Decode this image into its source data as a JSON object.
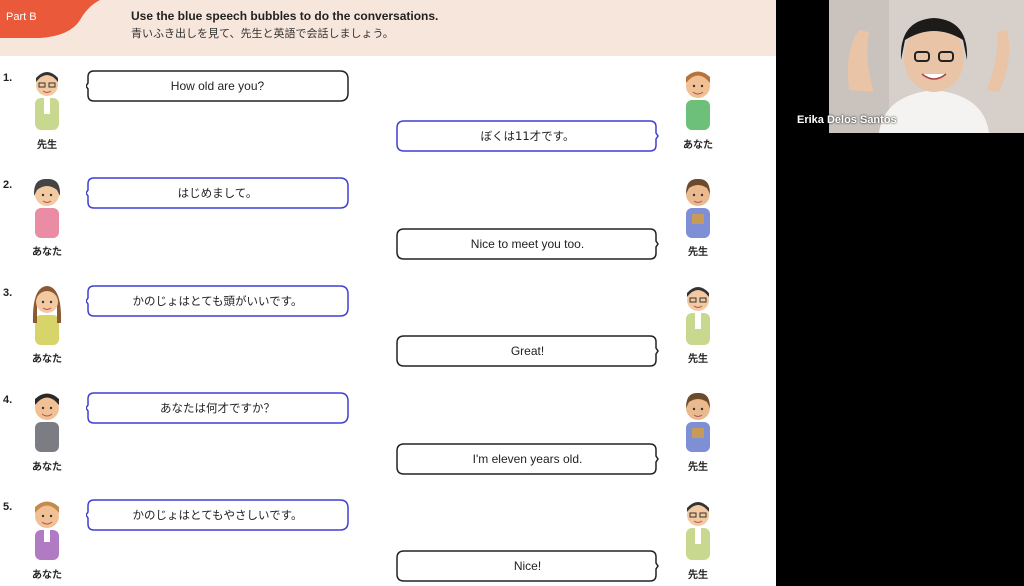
{
  "header": {
    "part_label": "Part B",
    "instruction_en": "Use the blue speech bubbles to do the conversations.",
    "instruction_ja": "青いふき出しを見て、先生と英語で会話しましょう。"
  },
  "conversations": [
    {
      "number": "1.",
      "left_speaker": "先生",
      "left_text": "How old are you?",
      "right_text": "ぼくは11才です。",
      "right_speaker": "あなた"
    },
    {
      "number": "2.",
      "left_speaker": "あなた",
      "left_text": "はじめまして。",
      "right_text": "Nice to meet you too.",
      "right_speaker": "先生"
    },
    {
      "number": "3.",
      "left_speaker": "あなた",
      "left_text": "かのじょはとても頭がいいです。",
      "right_text": "Great!",
      "right_speaker": "先生"
    },
    {
      "number": "4.",
      "left_speaker": "あなた",
      "left_text": "あなたは何才ですか？",
      "right_text": "I'm eleven years old.",
      "right_speaker": "先生"
    },
    {
      "number": "5.",
      "left_speaker": "あなた",
      "left_text": "かのじょはとてもやさしいです。",
      "right_text": "Nice!",
      "right_speaker": "先生"
    }
  ],
  "video": {
    "participant_name": "Erika Delos Santos"
  },
  "colors": {
    "header_bg": "#f7e6dc",
    "tab": "#e9593a",
    "blue_bubble": "#3f3fd1",
    "black_bubble": "#222222"
  }
}
